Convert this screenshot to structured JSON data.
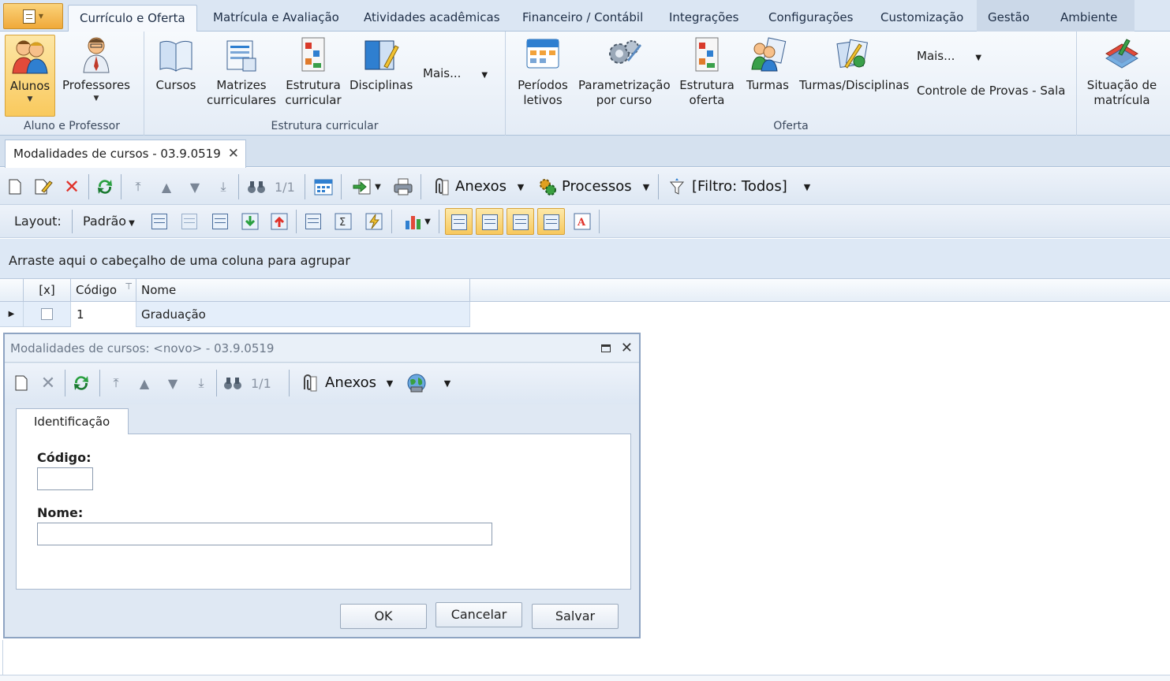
{
  "ribbon_tabs": [
    "Currículo e Oferta",
    "Matrícula e Avaliação",
    "Atividades acadêmicas",
    "Financeiro / Contábil",
    "Integrações",
    "Configurações",
    "Customização",
    "Gestão",
    "Ambiente"
  ],
  "ribbon": {
    "groups": {
      "aluno_professor": "Aluno e Professor",
      "estrutura_curricular": "Estrutura curricular",
      "oferta": "Oferta"
    },
    "buttons": {
      "alunos": "Alunos",
      "professores": "Professores",
      "cursos": "Cursos",
      "matrizes_1": "Matrizes",
      "matrizes_2": "curriculares",
      "estrutura_curricular_1": "Estrutura",
      "estrutura_curricular_2": "curricular",
      "disciplinas": "Disciplinas",
      "mais": "Mais...",
      "periodos_1": "Períodos",
      "periodos_2": "letivos",
      "parametrizacao_1": "Parametrização",
      "parametrizacao_2": "por curso",
      "estrutura_oferta_1": "Estrutura",
      "estrutura_oferta_2": "oferta",
      "turmas": "Turmas",
      "turmas_disciplinas": "Turmas/Disciplinas",
      "mais_oferta": "Mais...",
      "controle_provas": "Controle de Provas - Sala",
      "situacao_1": "Situação de",
      "situacao_2": "matrícula"
    }
  },
  "document_tab": "Modalidades de cursos - 03.9.0519",
  "toolbar": {
    "page_counter": "1/1",
    "anexos": "Anexos",
    "processos": "Processos",
    "filtro": "[Filtro: Todos]",
    "layout_label": "Layout:",
    "layout_value": "Padrão"
  },
  "group_hint": "Arraste aqui o cabeçalho de uma coluna para agrupar",
  "grid": {
    "columns": [
      "[x]",
      "Código",
      "Nome"
    ],
    "rows": [
      {
        "codigo": "1",
        "nome": "Graduação",
        "checked": false
      }
    ]
  },
  "dialog": {
    "title": "Modalidades de cursos: <novo> - 03.9.0519",
    "page_counter": "1/1",
    "anexos": "Anexos",
    "tab": "Identificação",
    "fields": {
      "codigo_label": "Código:",
      "codigo_value": "",
      "nome_label": "Nome:",
      "nome_value": ""
    },
    "buttons": {
      "ok": "OK",
      "cancelar": "Cancelar",
      "salvar": "Salvar"
    }
  }
}
